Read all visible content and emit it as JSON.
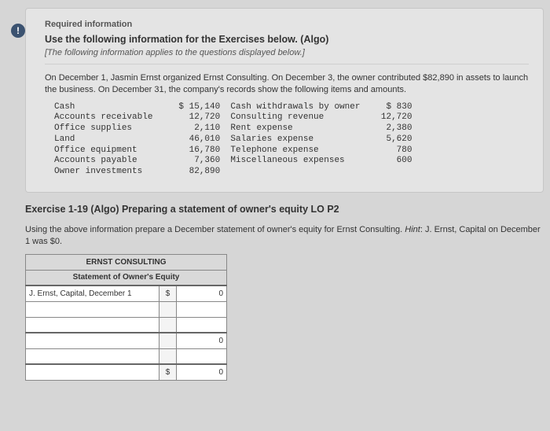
{
  "alert_glyph": "!",
  "card": {
    "required_label": "Required information",
    "use_heading": "Use the following information for the Exercises below. (Algo)",
    "applies_note": "[The following information applies to the questions displayed below.]",
    "intro": "On December 1, Jasmin Ernst organized Ernst Consulting. On December 3, the owner contributed $82,890 in assets to launch the business. On December 31, the company's records show the following items and amounts.",
    "ledger_text": "Cash                    $ 15,140  Cash withdrawals by owner     $ 830\nAccounts receivable       12,720  Consulting revenue           12,720\nOffice supplies            2,110  Rent expense                  2,380\nLand                      46,010  Salaries expense              5,620\nOffice equipment          16,780  Telephone expense               780\nAccounts payable           7,360  Miscellaneous expenses          600\nOwner investments         82,890"
  },
  "exercise": {
    "heading": "Exercise 1-19 (Algo) Preparing a statement of owner's equity LO P2",
    "instruction_a": "Using the above information prepare a December statement of owner's equity for Ernst Consulting. ",
    "hint_label": "Hint",
    "instruction_b": ": J. Ernst, Capital on December 1 was $0."
  },
  "worksheet": {
    "title": "ERNST CONSULTING",
    "subtitle": "Statement of Owner's Equity",
    "row1_label": "J. Ernst, Capital, December 1",
    "sign": "$",
    "zero": "0"
  }
}
